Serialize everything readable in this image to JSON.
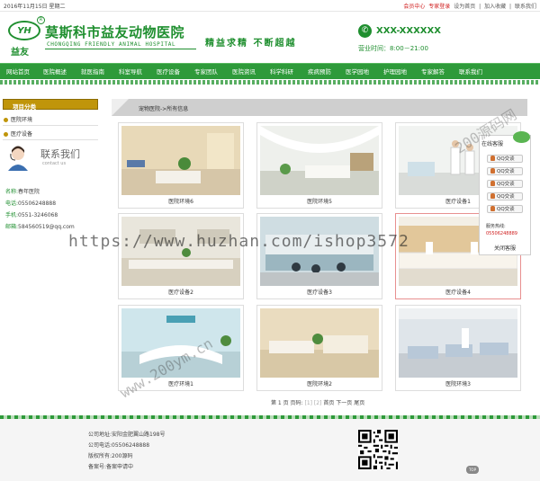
{
  "topbar": {
    "date": "2016年11月15日 星期二",
    "member_center": "会员中心",
    "expert_login": "专家登录",
    "set_home": "设为首页",
    "separator": "|",
    "add_favorite": "加入收藏",
    "contact_us": "联系我们"
  },
  "header": {
    "logo_sub": "益友",
    "site_name": "莫斯科市益友动物医院",
    "site_name_en": "CHONGQING FRIENDLY ANIMAL HOSPITAL",
    "slogan": "精益求精  不断超越",
    "phone": "XXX-XXXXXX",
    "hours": "营业时间：8:00－21:00"
  },
  "nav": {
    "items": [
      "网站首页",
      "医院概述",
      "就医指南",
      "科室导航",
      "医疗设备",
      "专家团队",
      "医院资讯",
      "科学科研",
      "疾病预防",
      "医学园地",
      "护理园地",
      "专家解答",
      "联系我们"
    ]
  },
  "sidebar": {
    "category_title": "项目分类",
    "items": [
      "医院环境",
      "医疗设备"
    ],
    "contact_title": "联系我们",
    "contact_en": "contact us",
    "contact": {
      "name_label": "名称:",
      "name": "春年医院",
      "phone_label": "电话:",
      "phone": "05506248888",
      "mobile_label": "手机:",
      "mobile": "0551-3246068",
      "email_label": "邮箱:",
      "email": "584560519@qq.com"
    }
  },
  "breadcrumb": "宠物医院->所有信息",
  "gallery": [
    {
      "caption": "医院环境6"
    },
    {
      "caption": "医院环境5"
    },
    {
      "caption": "医疗设备1"
    },
    {
      "caption": "医疗设备2"
    },
    {
      "caption": "医疗设备3"
    },
    {
      "caption": "医疗设备4"
    },
    {
      "caption": "医疗环境1"
    },
    {
      "caption": "医院环境2"
    },
    {
      "caption": "医院环境3"
    }
  ],
  "pager": {
    "text": "第 1 页 页码:",
    "pages": "[1] [2]",
    "first": "首页",
    "next": "下一页",
    "last": "尾页"
  },
  "online_service": {
    "title": "在线客服",
    "qq_label": "QQ交谈",
    "count": 5,
    "service_phone_label": "服务热线:",
    "service_phone": "05506248889",
    "close": "关闭客服"
  },
  "footer": {
    "address": "公司地址:安阳金肥翼山路198号",
    "phone": "公司电话:05506248888",
    "copyright": "版权所有:200源码",
    "icp": "备案号:备案申请中"
  },
  "to_top": "TOP",
  "watermark": {
    "url1": "https://www.huzhan.com/ishop3572",
    "url2": "www.200ym.cn",
    "url3": "200源码网"
  },
  "colors": {
    "brand_green": "#2e9a3a",
    "gold": "#c0950a",
    "red": "#d02020"
  }
}
